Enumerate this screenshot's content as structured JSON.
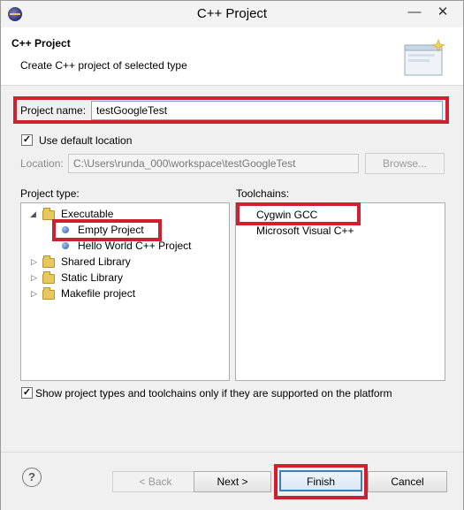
{
  "window": {
    "title": "C++ Project",
    "minimize": "—",
    "close": "✕"
  },
  "header": {
    "title": "C++ Project",
    "description": "Create C++ project of selected type"
  },
  "project_name": {
    "label": "Project name:",
    "value": "testGoogleTest"
  },
  "default_location": {
    "checked": true,
    "label": "Use default location"
  },
  "location": {
    "label": "Location:",
    "value": "C:\\Users\\runda_000\\workspace\\testGoogleTest",
    "browse_label": "Browse..."
  },
  "project_type": {
    "label": "Project type:",
    "items": [
      {
        "label": "Executable",
        "expanded": true
      },
      {
        "label": "Empty Project",
        "selected": true
      },
      {
        "label": "Hello World C++ Project"
      },
      {
        "label": "Shared Library"
      },
      {
        "label": "Static Library"
      },
      {
        "label": "Makefile project"
      }
    ]
  },
  "toolchains": {
    "label": "Toolchains:",
    "items": [
      "Cygwin GCC",
      "Microsoft Visual C++"
    ]
  },
  "filter": {
    "checked": true,
    "label": "Show project types and toolchains only if they are supported on the platform"
  },
  "buttons": {
    "help": "?",
    "back": "< Back",
    "next": "Next >",
    "finish": "Finish",
    "cancel": "Cancel"
  },
  "colors": {
    "highlight_red": "#d0202f",
    "focus_blue": "#3c7fb1"
  }
}
